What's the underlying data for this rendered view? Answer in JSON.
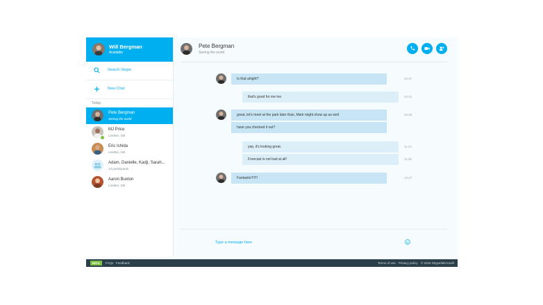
{
  "me": {
    "name": "Will Bergman",
    "status": "Available"
  },
  "sidebar": {
    "search_label": "Search Skype",
    "new_chat_label": "New Chat",
    "section_label": "Today",
    "contacts": [
      {
        "name": "Pete Bergman",
        "sub": "Seeing the world"
      },
      {
        "name": "MJ Price",
        "sub": "London, GB"
      },
      {
        "name": "Eric Ishida",
        "sub": "London, GB"
      },
      {
        "name": "Adam, Danielle, Kadji, Sarah...",
        "sub": "14 participants"
      },
      {
        "name": "Aaron Buxton",
        "sub": "London, GB"
      }
    ]
  },
  "chat": {
    "name": "Pete Bergman",
    "status": "Seeing the world",
    "buttons": [
      "call-icon",
      "video-icon",
      "add-contact-icon"
    ],
    "messages": [
      {
        "text": "Is that alright?",
        "time": "10:27"
      },
      {
        "text": "that's good for me too",
        "time": "10:31"
      },
      {
        "text": "great, let's meet at the park later than, Mark might show up as well",
        "time": "10:58"
      },
      {
        "text": "have you checked it out?",
        "time": ""
      },
      {
        "text": "yep, it's looking great.",
        "time": "11:34"
      },
      {
        "text": "Forecast is not bad at all!",
        "time": "11:35"
      },
      {
        "text": "Fantastic!!!!!!!",
        "time": "12:27"
      }
    ],
    "composer_placeholder": "Type a message here"
  },
  "footer": {
    "beta": "BETA",
    "faqs": "FAQs",
    "feedback": "Feedback",
    "terms": "Terms of use",
    "privacy": "Privacy policy",
    "copyright": "© 2015 Skype/Microsoft"
  },
  "colors": {
    "accent": "#00aff0",
    "footer": "#2b3f4a",
    "presence": "#7dc242"
  }
}
